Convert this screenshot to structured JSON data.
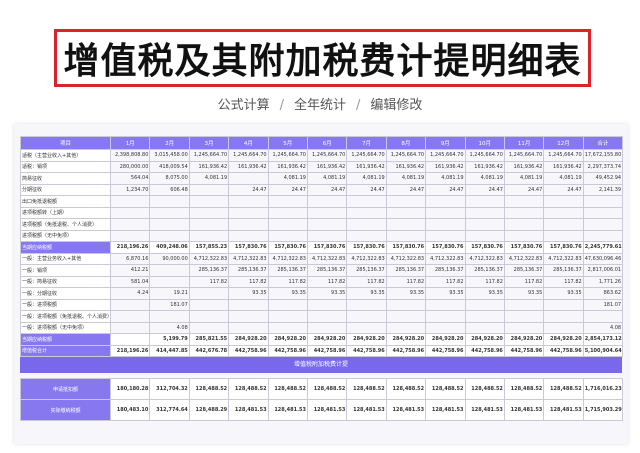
{
  "title": "增值税及其附加税费计提明细表",
  "subtitle": [
    "公式计算",
    "全年统计",
    "编辑修改"
  ],
  "subtitle_sep": "/",
  "colors": {
    "header_purple": "#8778f0",
    "title_border": "#d9242b"
  },
  "table": {
    "headers": [
      "项目",
      "1月",
      "2月",
      "3月",
      "4月",
      "5月",
      "6月",
      "7月",
      "8月",
      "9月",
      "10月",
      "11月",
      "12月",
      "合计"
    ],
    "rows": [
      {
        "hl": false,
        "cells": [
          "适税（主营业收入+其他）",
          "2,398,808.80",
          "3,015,458.00",
          "1,245,664.70",
          "1,245,664.70",
          "1,245,664.70",
          "1,245,664.70",
          "1,245,664.70",
          "1,245,664.70",
          "1,245,664.70",
          "1,245,664.70",
          "1,245,664.70",
          "1,245,664.70",
          "17,672,155.80"
        ]
      },
      {
        "hl": false,
        "cells": [
          "适税：销项",
          "280,000.00",
          "418,009.54",
          "161,936.42",
          "161,936.42",
          "161,936.42",
          "161,936.42",
          "161,936.42",
          "161,936.42",
          "161,936.42",
          "161,936.42",
          "161,936.42",
          "161,936.42",
          "2,297,373.74"
        ]
      },
      {
        "hl": false,
        "cells": [
          "简易征收",
          "564.04",
          "8,075.00",
          "4,081.19",
          "",
          "4,081.19",
          "4,081.19",
          "4,081.19",
          "4,081.19",
          "4,081.19",
          "4,081.19",
          "4,081.19",
          "4,081.19",
          "49,452.94"
        ]
      },
      {
        "hl": false,
        "cells": [
          "分期征收",
          "1,234.70",
          "606.48",
          "",
          "24.47",
          "24.47",
          "24.47",
          "24.47",
          "24.47",
          "24.47",
          "24.47",
          "24.47",
          "24.47",
          "2,141.39"
        ]
      },
      {
        "hl": false,
        "cells": [
          "出口免抵退税额",
          "",
          "",
          "",
          "",
          "",
          "",
          "",
          "",
          "",
          "",
          "",
          "",
          ""
        ]
      },
      {
        "hl": false,
        "cells": [
          "进项税额转（上期）",
          "",
          "",
          "",
          "",
          "",
          "",
          "",
          "",
          "",
          "",
          "",
          "",
          ""
        ]
      },
      {
        "hl": false,
        "cells": [
          "进项税额（免抵退税、个人消费）",
          "",
          "",
          "",
          "",
          "",
          "",
          "",
          "",
          "",
          "",
          "",
          "",
          ""
        ]
      },
      {
        "hl": false,
        "cells": [
          "进项税额（无中免项）",
          "",
          "",
          "",
          "",
          "",
          "",
          "",
          "",
          "",
          "",
          "",
          "",
          ""
        ]
      },
      {
        "hl": true,
        "cells": [
          "当期应纳税额",
          "218,196.26",
          "409,248.06",
          "157,855.23",
          "157,830.76",
          "157,830.76",
          "157,830.76",
          "157,830.76",
          "157,830.76",
          "157,830.76",
          "157,830.76",
          "157,830.76",
          "157,830.76",
          "2,245,779.61"
        ]
      },
      {
        "hl": false,
        "cells": [
          "一般：主营业务收入+其他",
          "6,870.16",
          "90,000.00",
          "4,712,322.83",
          "4,712,322.83",
          "4,712,322.83",
          "4,712,322.83",
          "4,712,322.83",
          "4,712,322.83",
          "4,712,322.83",
          "4,712,322.83",
          "4,712,322.83",
          "4,712,322.83",
          "47,630,096.46"
        ]
      },
      {
        "hl": false,
        "cells": [
          "一般：销项",
          "412.21",
          "",
          "285,136.37",
          "285,136.37",
          "285,136.37",
          "285,136.37",
          "285,136.37",
          "285,136.37",
          "285,136.37",
          "285,136.37",
          "285,136.37",
          "285,136.37",
          "2,817,006.01"
        ]
      },
      {
        "hl": false,
        "cells": [
          "一般：简易征收",
          "581.04",
          "",
          "117.82",
          "117.82",
          "117.82",
          "117.82",
          "117.82",
          "117.82",
          "117.82",
          "117.82",
          "117.82",
          "117.82",
          "1,771.26"
        ]
      },
      {
        "hl": false,
        "cells": [
          "一般：分期征收",
          "4.24",
          "19.21",
          "",
          "93.35",
          "93.35",
          "93.35",
          "93.35",
          "93.35",
          "93.35",
          "93.35",
          "93.35",
          "93.35",
          "863.62"
        ]
      },
      {
        "hl": false,
        "cells": [
          "一般：进项税额",
          "",
          "181.07",
          "",
          "",
          "",
          "",
          "",
          "",
          "",
          "",
          "",
          "",
          "181.07"
        ]
      },
      {
        "hl": false,
        "cells": [
          "一般：进项税额（免抵退税、个人消费）",
          "",
          "",
          "",
          "",
          "",
          "",
          "",
          "",
          "",
          "",
          "",
          "",
          ""
        ]
      },
      {
        "hl": false,
        "cells": [
          "一般：进项税额（无中免项）",
          "",
          "4.08",
          "",
          "",
          "",
          "",
          "",
          "",
          "",
          "",
          "",
          "",
          "4.08"
        ]
      },
      {
        "hl": true,
        "cells": [
          "当期应纳税额",
          "",
          "5,199.79",
          "285,821.55",
          "284,928.20",
          "284,928.20",
          "284,928.20",
          "284,928.20",
          "284,928.20",
          "284,928.20",
          "284,928.20",
          "284,928.20",
          "284,928.20",
          "2,854,173.12"
        ]
      },
      {
        "hl": true,
        "cells": [
          "增值税合计",
          "218,196.26",
          "414,447.85",
          "442,676.78",
          "442,758.96",
          "442,758.96",
          "442,758.96",
          "442,758.96",
          "442,758.96",
          "442,758.96",
          "442,758.96",
          "442,758.96",
          "442,758.96",
          "5,100,904.64"
        ]
      }
    ]
  },
  "section_title": "增值税附加税费计提",
  "bottom_rows": [
    {
      "cells": [
        "申请抵扣额",
        "180,180.28",
        "312,704.32",
        "128,488.52",
        "128,488.52",
        "128,488.52",
        "128,488.52",
        "128,488.52",
        "128,488.52",
        "128,488.52",
        "128,488.52",
        "128,488.52",
        "128,488.52",
        "1,716,016.23"
      ]
    },
    {
      "cells": [
        "实际缴纳税额",
        "180,483.10",
        "312,774.64",
        "128,488.29",
        "128,481.53",
        "128,481.53",
        "128,481.53",
        "128,481.53",
        "128,481.53",
        "128,481.53",
        "128,481.53",
        "128,481.53",
        "128,481.53",
        "1,715,903.29"
      ]
    }
  ]
}
